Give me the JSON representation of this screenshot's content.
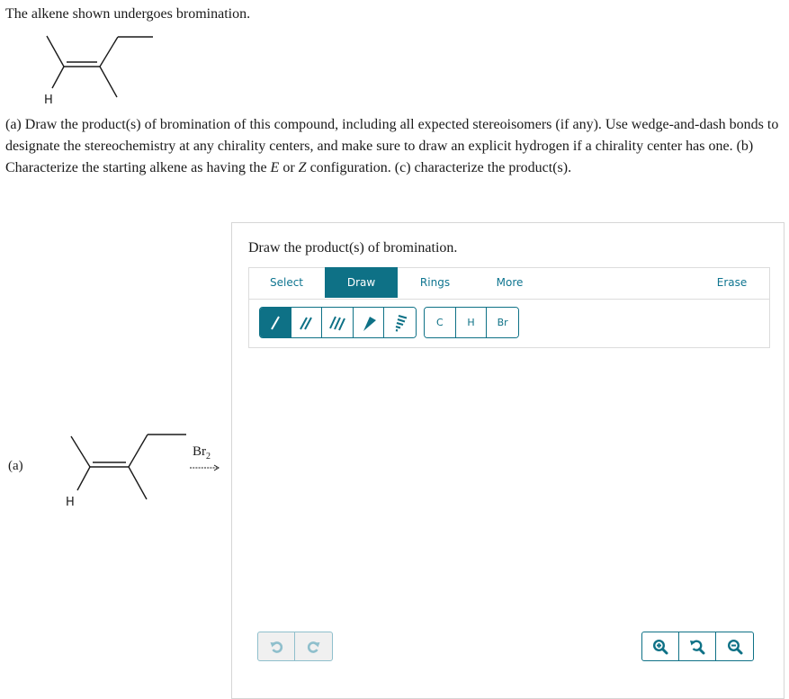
{
  "intro": "The alkene shown undergoes bromination.",
  "question": {
    "part1": "(a) Draw the product(s) of bromination of this compound, including all expected stereoisomers (if any). Use wedge-and-dash bonds to designate the stereochemistry at any chirality centers, and make sure to draw an explicit hydrogen if a chirality center has one. (b) Characterize the starting alkene as having the ",
    "E": "E",
    "or": " or ",
    "Z": "Z",
    "part2": " configuration. (c) characterize the product(s)."
  },
  "molecule": {
    "h_label": "H"
  },
  "reaction": {
    "part_label": "(a)",
    "reagent_main": "Br",
    "reagent_sub": "2"
  },
  "panel": {
    "title": "Draw the product(s) of bromination.",
    "tabs": [
      {
        "label": "Select",
        "active": false
      },
      {
        "label": "Draw",
        "active": true
      },
      {
        "label": "Rings",
        "active": false
      },
      {
        "label": "More",
        "active": false
      },
      {
        "label": "Erase",
        "active": false
      }
    ],
    "bond_tools": [
      "single-bond",
      "double-bond",
      "triple-bond",
      "wedge-bond",
      "dash-bond"
    ],
    "atoms": [
      "C",
      "H",
      "Br"
    ],
    "colors": {
      "accent": "#0e7186",
      "tab_text": "#0f7590",
      "disabled": "#8fbfcc"
    }
  }
}
